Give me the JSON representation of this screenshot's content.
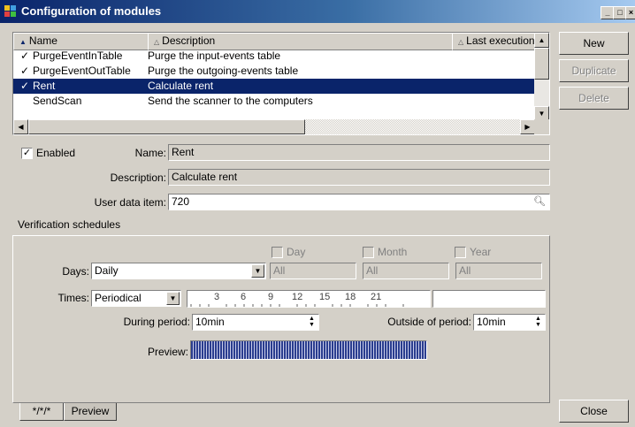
{
  "window": {
    "title": "Configuration of modules"
  },
  "list": {
    "columns": [
      "Name",
      "Description",
      "Last execution"
    ],
    "rows": [
      {
        "checked": true,
        "name": "PurgeEventInTable",
        "description": "Purge the input-events table"
      },
      {
        "checked": true,
        "name": "PurgeEventOutTable",
        "description": "Purge the outgoing-events table"
      },
      {
        "checked": true,
        "name": "Rent",
        "description": "Calculate rent",
        "selected": true
      },
      {
        "checked": false,
        "name": "SendScan",
        "description": "Send the scanner to the computers"
      }
    ]
  },
  "buttons": {
    "new": "New",
    "duplicate": "Duplicate",
    "delete": "Delete",
    "close": "Close"
  },
  "details": {
    "enabled_label": "Enabled",
    "name_label": "Name:",
    "name_value": "Rent",
    "description_label": "Description:",
    "description_value": "Calculate rent",
    "userdata_label": "User data item:",
    "userdata_value": "720"
  },
  "schedules": {
    "section_label": "Verification schedules",
    "day_label": "Day",
    "month_label": "Month",
    "year_label": "Year",
    "days_label": "Days:",
    "days_value": "Daily",
    "day_value": "All",
    "month_value": "All",
    "year_value": "All",
    "times_label": "Times:",
    "times_value": "Periodical",
    "ruler_ticks": [
      "3",
      "6",
      "9",
      "12",
      "15",
      "18",
      "21"
    ],
    "during_label": "During period:",
    "during_value": "10min",
    "outside_label": "Outside of period:",
    "outside_value": "10min",
    "preview_label": "Preview:"
  },
  "tabs": [
    "*/*/*",
    "Preview"
  ]
}
